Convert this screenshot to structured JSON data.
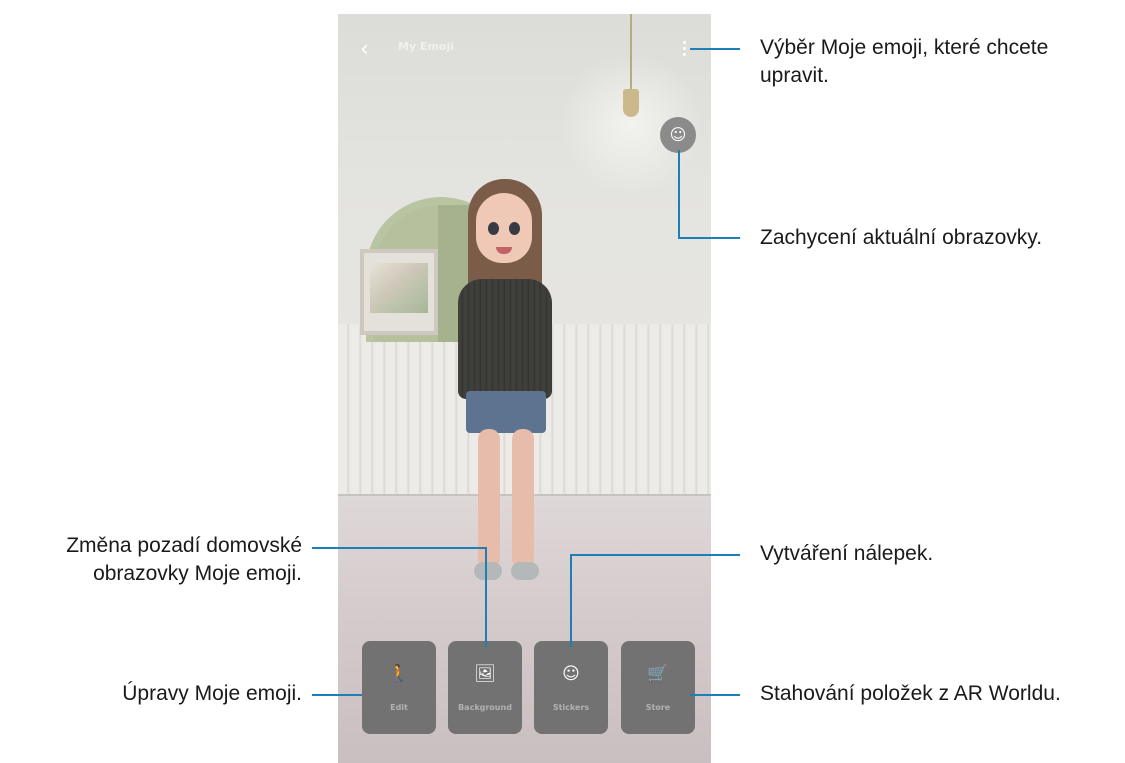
{
  "app": {
    "title": "My Emoji"
  },
  "top_bar": {
    "back_icon": "chevron-left-icon",
    "more_icon": "more-vertical-icon"
  },
  "capture": {
    "icon": "face-scan-icon"
  },
  "toolbar": {
    "buttons": [
      {
        "label": "Edit",
        "icon": "person-icon",
        "glyph": "🚶"
      },
      {
        "label": "Background",
        "icon": "image-icon",
        "glyph": "🖼"
      },
      {
        "label": "Stickers",
        "icon": "sticker-icon",
        "glyph": "☺"
      },
      {
        "label": "Store",
        "icon": "cart-icon",
        "glyph": "🛒"
      }
    ]
  },
  "callouts": {
    "select_emoji": "Výběr Moje emoji, které chcete upravit.",
    "capture_screen": "Zachycení aktuální obrazovky.",
    "change_background": "Změna pozadí domovské obrazovky Moje emoji.",
    "create_stickers": "Vytváření nálepek.",
    "edit_emoji": "Úpravy Moje emoji.",
    "download_items": "Stahování položek z AR Worldu."
  },
  "colors": {
    "leader_line": "#1e7fb8",
    "button_bg": "#727272",
    "capture_bg": "#8b8b8b"
  }
}
